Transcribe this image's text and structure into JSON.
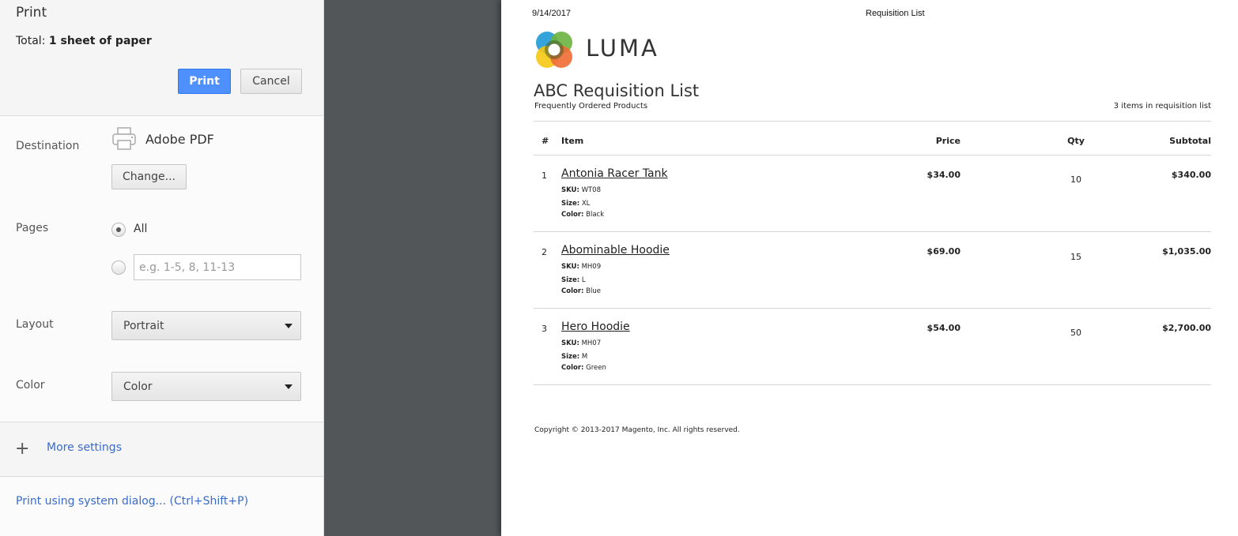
{
  "sidebar": {
    "title": "Print",
    "total_label": "Total:",
    "total_value": "1 sheet of paper",
    "print_button": "Print",
    "cancel_button": "Cancel",
    "destination": {
      "label": "Destination",
      "icon": "printer-icon",
      "value": "Adobe PDF",
      "change_button": "Change..."
    },
    "pages": {
      "label": "Pages",
      "all_label": "All",
      "all_selected": true,
      "custom_placeholder": "e.g. 1-5, 8, 11-13",
      "custom_value": ""
    },
    "layout": {
      "label": "Layout",
      "selected": "Portrait"
    },
    "color": {
      "label": "Color",
      "selected": "Color"
    },
    "more_settings": {
      "icon": "plus-icon",
      "label": "More settings"
    },
    "system_dialog_link": "Print using system dialog... (Ctrl+Shift+P)"
  },
  "preview": {
    "header_date": "9/14/2017",
    "header_title": "Requisition List",
    "logo_text": "LUMA",
    "list_title": "ABC Requisition List",
    "list_subtitle": "Frequently Ordered Products",
    "item_count": "3 items in requisition list",
    "columns": {
      "num": "#",
      "item": "Item",
      "price": "Price",
      "qty": "Qty",
      "subtotal": "Subtotal"
    },
    "rows": [
      {
        "num": "1",
        "name": "Antonia Racer Tank",
        "sku_label": "SKU:",
        "sku": "WT08",
        "size_label": "Size:",
        "size": "XL",
        "color_label": "Color:",
        "color": "Black",
        "price": "$34.00",
        "qty": "10",
        "subtotal": "$340.00"
      },
      {
        "num": "2",
        "name": "Abominable Hoodie",
        "sku_label": "SKU:",
        "sku": "MH09",
        "size_label": "Size:",
        "size": "L",
        "color_label": "Color:",
        "color": "Blue",
        "price": "$69.00",
        "qty": "15",
        "subtotal": "$1,035.00"
      },
      {
        "num": "3",
        "name": "Hero Hoodie",
        "sku_label": "SKU:",
        "sku": "MH07",
        "size_label": "Size:",
        "size": "M",
        "color_label": "Color:",
        "color": "Green",
        "price": "$54.00",
        "qty": "50",
        "subtotal": "$2,700.00"
      }
    ],
    "copyright": "Copyright © 2013-2017 Magento, Inc. All rights reserved."
  },
  "colors": {
    "print_button": "#4d90fe",
    "link": "#3b6bc7",
    "preview_background": "#525659"
  }
}
